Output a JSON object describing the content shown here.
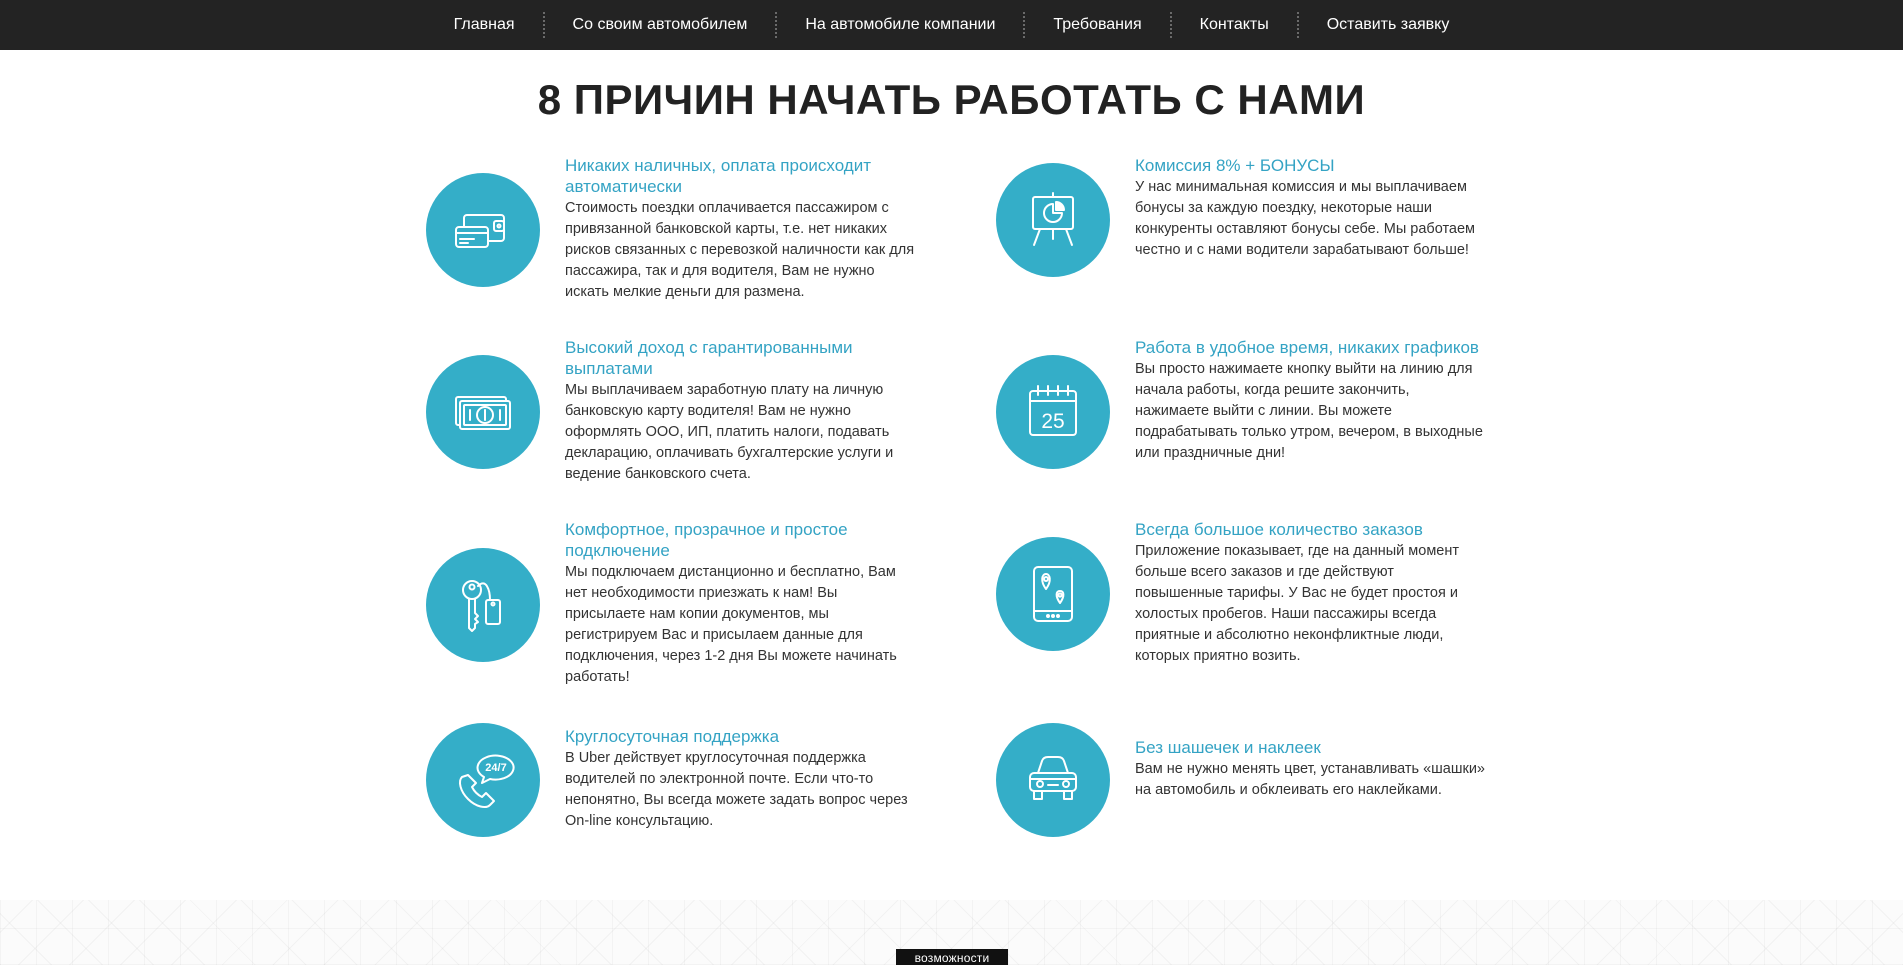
{
  "nav": {
    "items": [
      {
        "label": "Главная"
      },
      {
        "label": "Со своим автомобилем"
      },
      {
        "label": "На автомобиле компании"
      },
      {
        "label": "Требования"
      },
      {
        "label": "Контакты"
      },
      {
        "label": "Оставить заявку"
      }
    ]
  },
  "heading": "8 ПРИЧИН НАЧАТЬ РАБОТАТЬ С НАМИ",
  "accent_color": "#34aec8",
  "features": [
    {
      "icon": "wallet-card-icon",
      "title": "Никаких наличных, оплата происходит автоматически",
      "desc": "Стоимость поездки оплачивается пассажиром с привязанной банковской карты, т.е. нет никаких рисков связанных с перевозкой наличности как для пассажира, так и для водителя, Вам не нужно искать мелкие деньги для размена."
    },
    {
      "icon": "presentation-chart-icon",
      "title": "Комиссия 8% + БОНУСЫ",
      "desc": "У нас минимальная комиссия и мы выплачиваем бонусы за каждую поездку, некоторые наши конкуренты оставляют бонусы себе. Мы работаем честно и с нами водители зарабатывают больше!"
    },
    {
      "icon": "banknotes-icon",
      "title": "Высокий доход с гарантированными выплатами",
      "desc": "Мы выплачиваем заработную плату на личную банковскую карту водителя! Вам не нужно оформлять ООО, ИП, платить налоги, подавать декларацию, оплачивать бухгалтерские услуги и ведение банковского счета."
    },
    {
      "icon": "calendar-icon",
      "icon_text": "25",
      "title": "Работа в удобное время, никаких графиков",
      "desc": "Вы просто нажимаете кнопку выйти на линию для начала работы, когда решите закончить, нажимаете выйти с линии. Вы можете подрабатывать только утром, вечером, в выходные или праздничные дни!"
    },
    {
      "icon": "key-tag-icon",
      "title": "Комфортное, прозрачное и простое подключение",
      "desc": "Мы подключаем дистанционно и бесплатно, Вам нет необходимости приезжать к нам! Вы присылаете нам копии документов, мы регистрируем Вас и присылаем данные для подключения, через 1-2 дня Вы можете начинать работать!"
    },
    {
      "icon": "tablet-map-pin-icon",
      "title": "Всегда большое количество заказов",
      "desc": "Приложение показывает, где на данный момент больше всего заказов и где действуют повышенные тарифы. У Вас не будет простоя и холостых пробегов. Наши пассажиры всегда приятные и абсолютно неконфликтные люди, которых приятно возить."
    },
    {
      "icon": "phone-24-7-icon",
      "icon_text": "24/7",
      "title": "Круглосуточная поддержка",
      "desc": "В Uber действует круглосуточная поддержка водителей по электронной почте. Если что-то непонятно, Вы всегда можете задать вопрос через On-line консультацию."
    },
    {
      "icon": "car-icon",
      "title": "Без шашечек и наклеек",
      "desc": "Вам не нужно менять цвет, устанавливать «шашки» на автомобиль и обклеивать его наклейками."
    }
  ],
  "bottom_tag": "возможности"
}
